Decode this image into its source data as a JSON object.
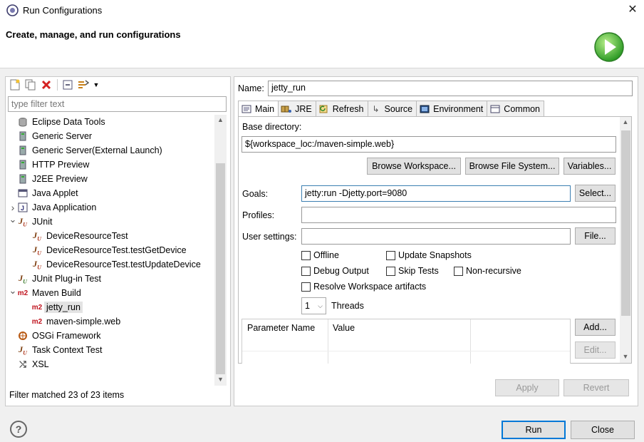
{
  "window": {
    "title": "Run Configurations",
    "close_icon": "close-icon"
  },
  "banner": {
    "title": "Create, manage, and run configurations"
  },
  "left": {
    "filter_placeholder": "type filter text",
    "tree": [
      {
        "label": "Eclipse Data Tools",
        "icon": "database-icon",
        "level": 0,
        "twisty": ""
      },
      {
        "label": "Generic Server",
        "icon": "server-icon",
        "level": 0,
        "twisty": ""
      },
      {
        "label": "Generic Server(External Launch)",
        "icon": "server-icon",
        "level": 0,
        "twisty": ""
      },
      {
        "label": "HTTP Preview",
        "icon": "server-icon",
        "level": 0,
        "twisty": ""
      },
      {
        "label": "J2EE Preview",
        "icon": "server-icon",
        "level": 0,
        "twisty": ""
      },
      {
        "label": "Java Applet",
        "icon": "applet-icon",
        "level": 0,
        "twisty": ""
      },
      {
        "label": "Java Application",
        "icon": "java-app-icon",
        "level": 0,
        "twisty": ">"
      },
      {
        "label": "JUnit",
        "icon": "junit-icon",
        "level": 0,
        "twisty": "v"
      },
      {
        "label": "DeviceResourceTest",
        "icon": "junit-icon",
        "level": 1,
        "twisty": ""
      },
      {
        "label": "DeviceResourceTest.testGetDevice",
        "icon": "junit-icon",
        "level": 1,
        "twisty": ""
      },
      {
        "label": "DeviceResourceTest.testUpdateDevice",
        "icon": "junit-icon",
        "level": 1,
        "twisty": ""
      },
      {
        "label": "JUnit Plug-in Test",
        "icon": "junit-plugin-icon",
        "level": 0,
        "twisty": ""
      },
      {
        "label": "Maven Build",
        "icon": "maven-icon",
        "level": 0,
        "twisty": "v"
      },
      {
        "label": "jetty_run",
        "icon": "maven-icon",
        "level": 1,
        "twisty": "",
        "selected": true
      },
      {
        "label": "maven-simple.web",
        "icon": "maven-icon",
        "level": 1,
        "twisty": ""
      },
      {
        "label": "OSGi Framework",
        "icon": "osgi-icon",
        "level": 0,
        "twisty": ""
      },
      {
        "label": "Task Context Test",
        "icon": "junit-icon",
        "level": 0,
        "twisty": ""
      },
      {
        "label": "XSL",
        "icon": "xsl-icon",
        "level": 0,
        "twisty": ""
      }
    ],
    "filter_status": "Filter matched 23 of 23 items"
  },
  "right": {
    "name_label": "Name:",
    "name_value": "jetty_run",
    "tabs": [
      {
        "label": "Main",
        "icon": "main-tab-icon",
        "active": true
      },
      {
        "label": "JRE",
        "icon": "jre-icon"
      },
      {
        "label": "Refresh",
        "icon": "refresh-icon"
      },
      {
        "label": "Source",
        "icon": "source-icon"
      },
      {
        "label": "Environment",
        "icon": "environment-icon"
      },
      {
        "label": "Common",
        "icon": "common-icon"
      }
    ],
    "base_dir_label": "Base directory:",
    "base_dir_value": "${workspace_loc:/maven-simple.web}",
    "browse_workspace": "Browse Workspace...",
    "browse_fs": "Browse File System...",
    "variables": "Variables...",
    "goals_label": "Goals:",
    "goals_value": "jetty:run -Djetty.port=9080",
    "select_btn": "Select...",
    "profiles_label": "Profiles:",
    "profiles_value": "",
    "user_settings_label": "User settings:",
    "user_settings_value": "",
    "file_btn": "File...",
    "checkboxes": {
      "offline": "Offline",
      "update_snapshots": "Update Snapshots",
      "debug_output": "Debug Output",
      "skip_tests": "Skip Tests",
      "non_recursive": "Non-recursive",
      "resolve_workspace": "Resolve Workspace artifacts"
    },
    "threads_value": "1",
    "threads_label": "Threads",
    "param_header_name": "Parameter Name",
    "param_header_value": "Value",
    "add_btn": "Add...",
    "edit_btn": "Edit...",
    "apply_btn": "Apply",
    "revert_btn": "Revert"
  },
  "footer": {
    "run_btn": "Run",
    "close_btn": "Close",
    "help_icon": "help-icon"
  }
}
